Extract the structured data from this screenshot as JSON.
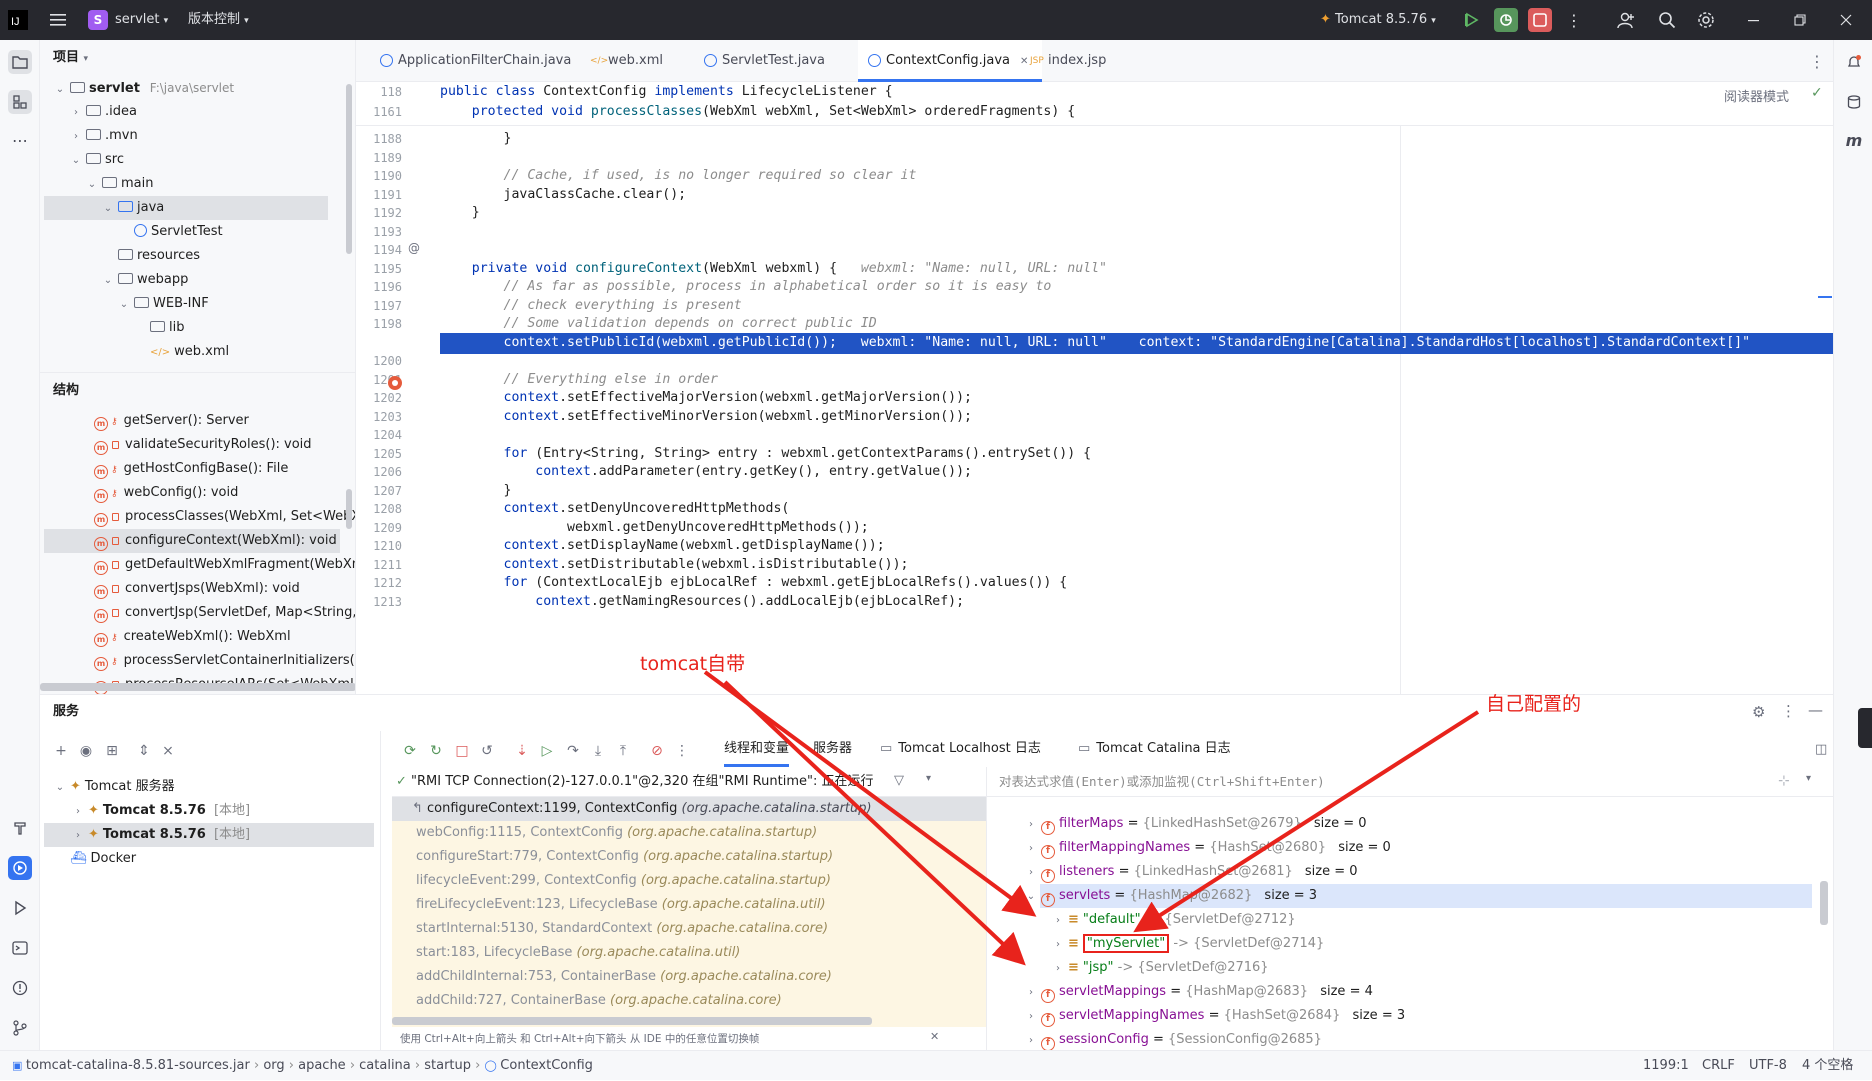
{
  "titlebar": {
    "project_badge": "S",
    "project_name": "servlet",
    "vcs_menu": "版本控制",
    "run_config": "Tomcat 8.5.76"
  },
  "project_panel": {
    "title": "项目",
    "tree": [
      {
        "label": "servlet",
        "extra": "F:\\java\\servlet",
        "depth": 0,
        "bold": true
      },
      {
        "label": ".idea",
        "depth": 1
      },
      {
        "label": ".mvn",
        "depth": 1
      },
      {
        "label": "src",
        "depth": 1
      },
      {
        "label": "main",
        "depth": 2
      },
      {
        "label": "java",
        "depth": 3,
        "selected": true
      },
      {
        "label": "ServletTest",
        "depth": 4
      },
      {
        "label": "resources",
        "depth": 3
      },
      {
        "label": "webapp",
        "depth": 3
      },
      {
        "label": "WEB-INF",
        "depth": 4
      },
      {
        "label": "lib",
        "depth": 5
      },
      {
        "label": "web.xml",
        "depth": 5
      }
    ]
  },
  "structure_panel": {
    "title": "结构",
    "items": [
      {
        "label": "getServer(): Server"
      },
      {
        "label": "validateSecurityRoles(): void"
      },
      {
        "label": "getHostConfigBase(): File"
      },
      {
        "label": "webConfig(): void"
      },
      {
        "label": "processClasses(WebXml, Set<WebXm"
      },
      {
        "label": "configureContext(WebXml): void",
        "selected": true
      },
      {
        "label": "getDefaultWebXmlFragment(WebXm"
      },
      {
        "label": "convertJsps(WebXml): void"
      },
      {
        "label": "convertJsp(ServletDef, Map<String, S"
      },
      {
        "label": "createWebXml(): WebXml"
      },
      {
        "label": "processServletContainerInitializers(): v"
      },
      {
        "label": "processResourceJARs(Set<WebXml>):"
      }
    ]
  },
  "tabs": [
    {
      "label": "ApplicationFilterChain.java"
    },
    {
      "label": "web.xml"
    },
    {
      "label": "ServletTest.java"
    },
    {
      "label": "ContextConfig.java",
      "active": true
    },
    {
      "label": "index.jsp"
    }
  ],
  "editor": {
    "reader_mode": "阅读器模式",
    "sticky": [
      {
        "num": "118",
        "html": "<span class='kw'>public class</span> ContextConfig <span class='kw'>implements</span> LifecycleListener {"
      },
      {
        "num": "1161",
        "html": "    <span class='kw'>protected void</span> <span class='fn'>processClasses</span>(WebXml webXml, Set&lt;WebXml&gt; orderedFragments) {"
      }
    ],
    "lines": [
      {
        "num": "1188",
        "html": "        }"
      },
      {
        "num": "1189",
        "html": ""
      },
      {
        "num": "1190",
        "html": "        <span class='cm'>// Cache, if used, is no longer required so clear it</span>"
      },
      {
        "num": "1191",
        "html": "        javaClassCache.clear();"
      },
      {
        "num": "1192",
        "html": "    }"
      },
      {
        "num": "1193",
        "html": ""
      },
      {
        "num": "1194",
        "html": ""
      },
      {
        "num": "1195",
        "html": "    <span class='kw'>private void</span> <span class='fn'>configureContext</span>(WebXml webxml) {   <span class='hint'>webxml: \"Name: null, URL: null\"</span>"
      },
      {
        "num": "1196",
        "html": "        <span class='cm'>// As far as possible, process in alphabetical order so it is easy to</span>"
      },
      {
        "num": "1197",
        "html": "        <span class='cm'>// check everything is present</span>"
      },
      {
        "num": "1198",
        "html": "        <span class='cm'>// Some validation depends on correct public ID</span>"
      },
      {
        "num": "1199",
        "html": "        context.setPublicId(webxml.getPublicId());   webxml: \"Name: null, URL: null\"    context: \"StandardEngine[Catalina].StandardHost[localhost].StandardContext[]\"",
        "exec": true
      },
      {
        "num": "1200",
        "html": ""
      },
      {
        "num": "1201",
        "html": "        <span class='cm'>// Everything else in order</span>"
      },
      {
        "num": "1202",
        "html": "        <span class='kw'>context</span>.setEffectiveMajorVersion(webxml.getMajorVersion());"
      },
      {
        "num": "1203",
        "html": "        <span class='kw'>context</span>.setEffectiveMinorVersion(webxml.getMinorVersion());"
      },
      {
        "num": "1204",
        "html": ""
      },
      {
        "num": "1205",
        "html": "        <span class='kw'>for</span> (Entry&lt;String, String&gt; entry : webxml.getContextParams().entrySet()) {"
      },
      {
        "num": "1206",
        "html": "            <span class='kw'>context</span>.addParameter(entry.getKey(), entry.getValue());"
      },
      {
        "num": "1207",
        "html": "        }"
      },
      {
        "num": "1208",
        "html": "        <span class='kw'>context</span>.setDenyUncoveredHttpMethods("
      },
      {
        "num": "1209",
        "html": "                webxml.getDenyUncoveredHttpMethods());"
      },
      {
        "num": "1210",
        "html": "        <span class='kw'>context</span>.setDisplayName(webxml.getDisplayName());"
      },
      {
        "num": "1211",
        "html": "        <span class='kw'>context</span>.setDistributable(webxml.isDistributable());"
      },
      {
        "num": "1212",
        "html": "        <span class='kw'>for</span> (ContextLocalEjb ejbLocalRef : webxml.getEjbLocalRefs().values()) {"
      },
      {
        "num": "1213",
        "html": "            <span class='kw'>context</span>.getNamingResources().addLocalEjb(ejbLocalRef);"
      }
    ]
  },
  "services": {
    "title": "服务",
    "tree": [
      {
        "label": "Tomcat 服务器",
        "depth": 0,
        "bold": false
      },
      {
        "label": "Tomcat 8.5.76",
        "extra": "[本地]",
        "depth": 1,
        "bold": true
      },
      {
        "label": "Tomcat 8.5.76",
        "extra": "[本地]",
        "depth": 1,
        "bold": true,
        "selected": true
      },
      {
        "label": "Docker",
        "depth": 0,
        "bold": false
      }
    ],
    "debug_tabs": [
      "线程和变量",
      "服务器",
      "Tomcat Localhost 日志",
      "Tomcat Catalina 日志"
    ],
    "thread": "\"RMI TCP Connection(2)-127.0.0.1\"@2,320 在组\"RMI Runtime\": 正在运行",
    "frames": [
      {
        "m": "configureContext:1199, ContextConfig",
        "p": "(org.apache.catalina.startup)",
        "current": true
      },
      {
        "m": "webConfig:1115, ContextConfig",
        "p": "(org.apache.catalina.startup)"
      },
      {
        "m": "configureStart:779, ContextConfig",
        "p": "(org.apache.catalina.startup)"
      },
      {
        "m": "lifecycleEvent:299, ContextConfig",
        "p": "(org.apache.catalina.startup)"
      },
      {
        "m": "fireLifecycleEvent:123, LifecycleBase",
        "p": "(org.apache.catalina.util)"
      },
      {
        "m": "startInternal:5130, StandardContext",
        "p": "(org.apache.catalina.core)"
      },
      {
        "m": "start:183, LifecycleBase",
        "p": "(org.apache.catalina.util)"
      },
      {
        "m": "addChildInternal:753, ContainerBase",
        "p": "(org.apache.catalina.core)"
      },
      {
        "m": "addChild:727, ContainerBase",
        "p": "(org.apache.catalina.core)"
      }
    ],
    "frames_hint": "使用 Ctrl+Alt+向上箭头 和 Ctrl+Alt+向下箭头 从 IDE 中的任意位置切换帧",
    "eval_placeholder": "对表达式求值(Enter)或添加监视(Ctrl+Shift+Enter)",
    "vars": [
      {
        "name": "filterMaps",
        "val": "{LinkedHashSet@2679}",
        "size": "size = 0",
        "depth": 0
      },
      {
        "name": "filterMappingNames",
        "val": "{HashSet@2680}",
        "size": "size = 0",
        "depth": 0
      },
      {
        "name": "listeners",
        "val": "{LinkedHashSet@2681}",
        "size": "size = 0",
        "depth": 0
      },
      {
        "name": "servlets",
        "val": "{HashMap@2682}",
        "size": "size = 3",
        "depth": 0,
        "selected": true,
        "expanded": true
      },
      {
        "name": "\"default\"",
        "val": "-> {ServletDef@2712}",
        "size": "",
        "depth": 1
      },
      {
        "name": "\"myServlet\"",
        "val": "-> {ServletDef@2714}",
        "size": "",
        "depth": 1,
        "boxed": true
      },
      {
        "name": "\"jsp\"",
        "val": "-> {ServletDef@2716}",
        "size": "",
        "depth": 1
      },
      {
        "name": "servletMappings",
        "val": "{HashMap@2683}",
        "size": "size = 4",
        "depth": 0
      },
      {
        "name": "servletMappingNames",
        "val": "{HashSet@2684}",
        "size": "size = 3",
        "depth": 0
      },
      {
        "name": "sessionConfig",
        "val": "{SessionConfig@2685}",
        "size": "",
        "depth": 0
      }
    ]
  },
  "annotations": {
    "tomcat_builtin": "tomcat自带",
    "self_config": "自己配置的"
  },
  "statusbar": {
    "crumbs": [
      "tomcat-catalina-8.5.81-sources.jar",
      "org",
      "apache",
      "catalina",
      "startup",
      "ContextConfig"
    ],
    "position": "1199:1",
    "line_sep": "CRLF",
    "encoding": "UTF-8",
    "indent": "4 个空格"
  },
  "colors": {
    "accent": "#3574f0",
    "annotation": "#e8231c",
    "exec_line": "#2154c4"
  }
}
